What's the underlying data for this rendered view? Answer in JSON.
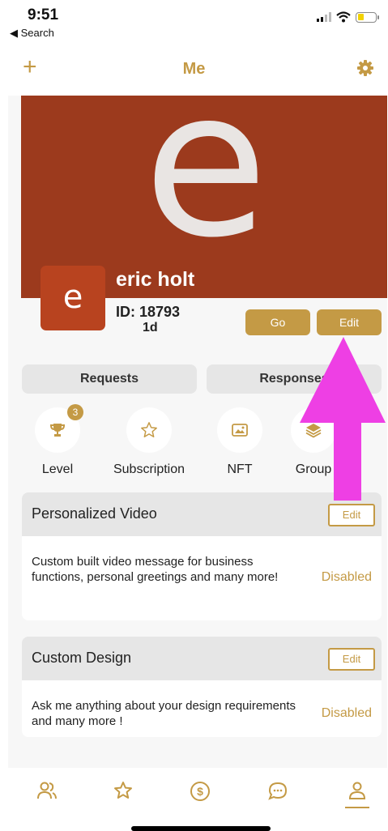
{
  "status_bar": {
    "time": "9:51",
    "back_label": "◀ Search"
  },
  "nav": {
    "title": "Me",
    "add_icon": "plus-icon",
    "settings_icon": "gear-icon"
  },
  "profile": {
    "cover_letter": "e",
    "avatar_letter": "e",
    "name": "eric holt",
    "id_text": "ID: 18793",
    "age_text": "1d",
    "go_label": "Go",
    "edit_label": "Edit"
  },
  "tabs": {
    "requests_label": "Requests",
    "responses_label": "Responses"
  },
  "stats": [
    {
      "label": "Level",
      "icon": "trophy-icon",
      "badge": "3"
    },
    {
      "label": "Subscription",
      "icon": "star-outline-icon"
    },
    {
      "label": "NFT",
      "icon": "image-icon"
    },
    {
      "label": "Group",
      "icon": "layers-icon"
    }
  ],
  "services": [
    {
      "title": "Personalized Video",
      "edit_label": "Edit",
      "description": "Custom built video message for business functions, personal greetings and many more!",
      "status": "Disabled"
    },
    {
      "title": "Custom Design",
      "edit_label": "Edit",
      "description": "Ask me anything about your design requirements and many more !",
      "status": "Disabled"
    }
  ],
  "tab_bar": [
    "people-icon",
    "star-icon",
    "dollar-icon",
    "chat-icon",
    "profile-icon"
  ],
  "colors": {
    "accent": "#c49a45",
    "cover": "#9c3a1d",
    "avatar": "#b8431f",
    "annotation": "#ee3fe4"
  }
}
